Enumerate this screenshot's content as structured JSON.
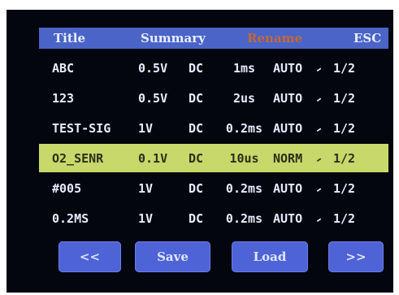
{
  "header": {
    "title": "Title",
    "summary": "Summary",
    "rename": "Rename",
    "esc": "ESC"
  },
  "rows": [
    {
      "name": "ABC",
      "volt": "0.5V",
      "coupling": "DC",
      "time": "1ms",
      "mode": "AUTO",
      "edge": "⹝",
      "page": "1/2",
      "selected": false
    },
    {
      "name": "123",
      "volt": "0.5V",
      "coupling": "DC",
      "time": "2us",
      "mode": "AUTO",
      "edge": "⹝",
      "page": "1/2",
      "selected": false
    },
    {
      "name": "TEST-SIG",
      "volt": "1V",
      "coupling": "DC",
      "time": "0.2ms",
      "mode": "AUTO",
      "edge": "⹝",
      "page": "1/2",
      "selected": false
    },
    {
      "name": "O2_SENR",
      "volt": "0.1V",
      "coupling": "DC",
      "time": "10us",
      "mode": "NORM",
      "edge": "⹝",
      "page": "1/2",
      "selected": true
    },
    {
      "name": "#005",
      "volt": "1V",
      "coupling": "DC",
      "time": "0.2ms",
      "mode": "AUTO",
      "edge": "⹝",
      "page": "1/2",
      "selected": false
    },
    {
      "name": "0.2MS",
      "volt": "1V",
      "coupling": "DC",
      "time": "0.2ms",
      "mode": "AUTO",
      "edge": "⹝",
      "page": "1/2",
      "selected": false
    }
  ],
  "buttons": {
    "prev": "<<",
    "save": "Save",
    "load": "Load",
    "next": ">>"
  },
  "colors": {
    "screen": "#03060e",
    "header": "#4a64c8",
    "selected_row": "#c8d86a",
    "rename_label": "#c26a38",
    "button": "#4e63d6"
  }
}
